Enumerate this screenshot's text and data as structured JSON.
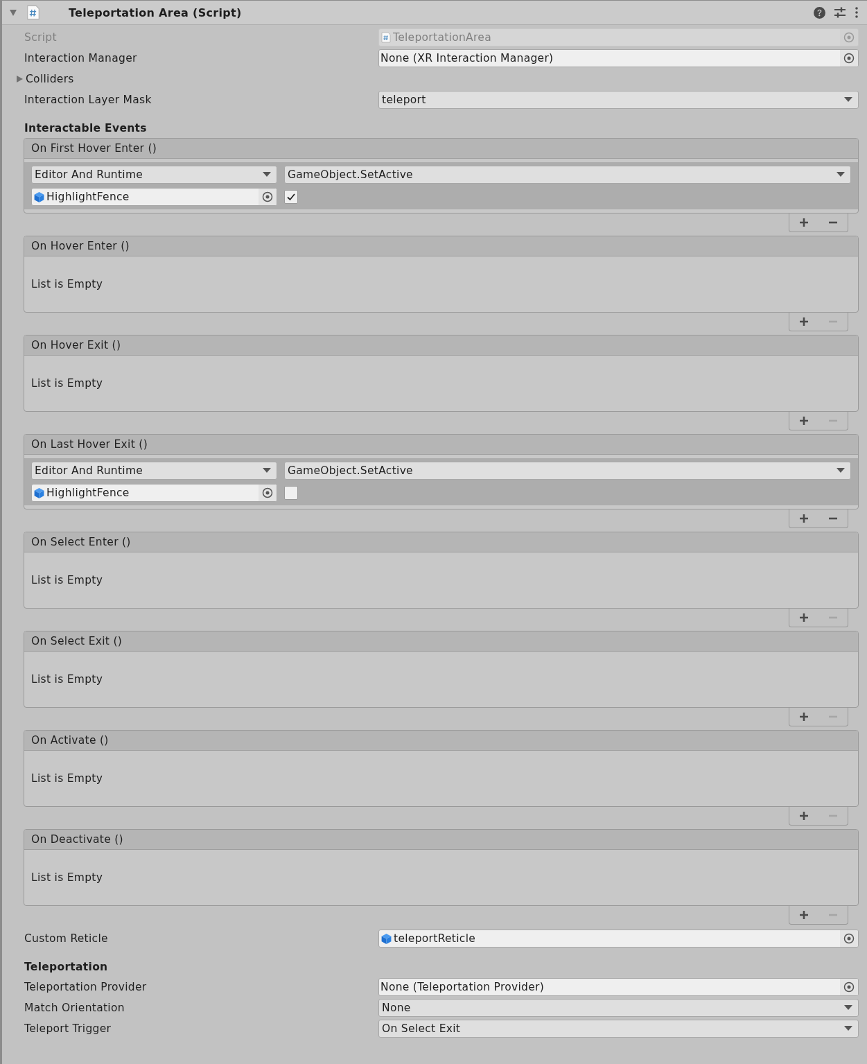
{
  "component": {
    "title": "Teleportation Area (Script)",
    "expanded": true
  },
  "properties": [
    {
      "kind": "script",
      "label": "Script",
      "value": "TeleportationArea",
      "disabled": true
    },
    {
      "kind": "object",
      "label": "Interaction Manager",
      "value": "None (XR Interaction Manager)",
      "disabled": false
    },
    {
      "kind": "foldout",
      "label": "Colliders",
      "expanded": false
    },
    {
      "kind": "dropdown",
      "label": "Interaction Layer Mask",
      "value": "teleport"
    },
    {
      "kind": "heading",
      "label": "Interactable Events"
    },
    {
      "kind": "event",
      "title": "On First Hover Enter ()",
      "remove_disabled": false,
      "listeners": [
        {
          "runtime": "Editor And Runtime",
          "function": "GameObject.SetActive",
          "target": "HighlightFence",
          "checked": true
        }
      ]
    },
    {
      "kind": "event",
      "title": "On Hover Enter ()",
      "remove_disabled": true,
      "empty_text": "List is Empty"
    },
    {
      "kind": "event",
      "title": "On Hover Exit ()",
      "remove_disabled": true,
      "empty_text": "List is Empty"
    },
    {
      "kind": "event",
      "title": "On Last Hover Exit ()",
      "remove_disabled": false,
      "listeners": [
        {
          "runtime": "Editor And Runtime",
          "function": "GameObject.SetActive",
          "target": "HighlightFence",
          "checked": false
        }
      ]
    },
    {
      "kind": "event",
      "title": "On Select Enter ()",
      "remove_disabled": true,
      "empty_text": "List is Empty"
    },
    {
      "kind": "event",
      "title": "On Select Exit ()",
      "remove_disabled": true,
      "empty_text": "List is Empty"
    },
    {
      "kind": "event",
      "title": "On Activate ()",
      "remove_disabled": true,
      "empty_text": "List is Empty"
    },
    {
      "kind": "event",
      "title": "On Deactivate ()",
      "remove_disabled": true,
      "empty_text": "List is Empty"
    },
    {
      "kind": "gameobject",
      "label": "Custom Reticle",
      "value": "teleportReticle",
      "disabled": false
    },
    {
      "kind": "heading",
      "label": "Teleportation"
    },
    {
      "kind": "object",
      "label": "Teleportation Provider",
      "value": "None (Teleportation Provider)",
      "disabled": false
    },
    {
      "kind": "dropdown",
      "label": "Match Orientation",
      "value": "None"
    },
    {
      "kind": "dropdown",
      "label": "Teleport Trigger",
      "value": "On Select Exit"
    }
  ]
}
